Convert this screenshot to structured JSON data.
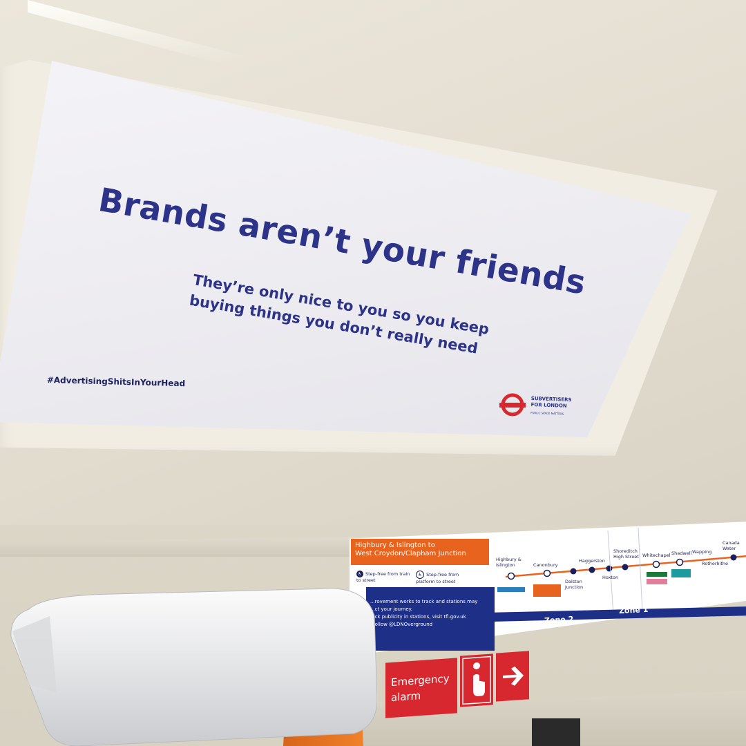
{
  "poster": {
    "headline": "Brands aren’t your friends",
    "subline_line1": "They’re only nice to you so you keep",
    "subline_line2": "buying things you don’t really need",
    "hashtag": "#AdvertisingShitsInYourHead",
    "org_line1": "SUBVERTISERS",
    "org_line2": "FOR LONDON",
    "org_tagline": "PUBLIC SPACE MATTERS",
    "headline_color": "#2c3388"
  },
  "line_map": {
    "header_line1": "Highbury & Islington to",
    "header_line2": "West Croydon/Clapham Junction",
    "legend": [
      {
        "icon": "wheelchair-icon",
        "label": "Step-free from train to street"
      },
      {
        "icon": "wheelchair-icon",
        "label": "Step-free from platform to street"
      }
    ],
    "notice_lines": [
      "...rovement works to track and stations may",
      "...ct your journey.",
      "...ck publicity in stations, visit tfl.gov.uk",
      "...ollow @LDNOverground"
    ],
    "stations": [
      "Highbury & Islington",
      "Canonbury",
      "Haggerston",
      "Dalston Junction",
      "Hoxton",
      "Shoreditch High Street",
      "Whitechapel",
      "Shadwell",
      "Wapping",
      "Rotherhithe",
      "Canada Water"
    ],
    "zone_2": "Zone 2",
    "zone_1": "Zone 1",
    "accent_orange": "#e8641e",
    "accent_navy": "#1d2f87"
  },
  "emergency": {
    "label_line1": "Emergency",
    "label_line2": "alarm",
    "color": "#d7282f"
  }
}
